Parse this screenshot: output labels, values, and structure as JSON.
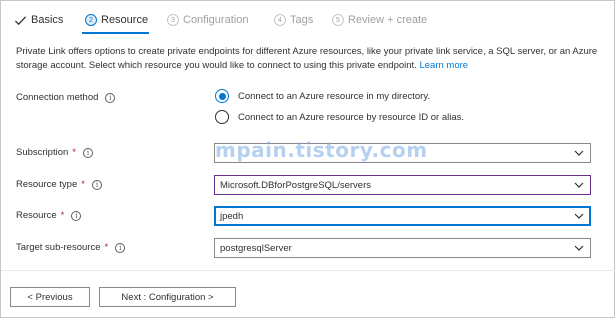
{
  "tabs": [
    {
      "label": "Basics",
      "state": "done"
    },
    {
      "num": "2",
      "label": "Resource",
      "state": "active"
    },
    {
      "num": "3",
      "label": "Configuration",
      "state": "disabled"
    },
    {
      "num": "4",
      "label": "Tags",
      "state": "disabled"
    },
    {
      "num": "5",
      "label": "Review + create",
      "state": "disabled"
    }
  ],
  "description": {
    "text": "Private Link offers options to create private endpoints for different Azure resources, like your private link service, a SQL server, or an Azure storage account. Select which resource you would like to connect to using this private endpoint.",
    "link": "Learn more"
  },
  "form": {
    "connection_method": {
      "label": "Connection method",
      "options": [
        {
          "label": "Connect to an Azure resource in my directory.",
          "checked": true
        },
        {
          "label": "Connect to an Azure resource by resource ID or alias.",
          "checked": false
        }
      ]
    },
    "subscription": {
      "label": "Subscription",
      "required": "*",
      "value": ""
    },
    "resource_type": {
      "label": "Resource type",
      "required": "*",
      "value": "Microsoft.DBforPostgreSQL/servers"
    },
    "resource": {
      "label": "Resource",
      "required": "*",
      "value": "jpedh"
    },
    "target_sub_resource": {
      "label": "Target sub-resource",
      "required": "*",
      "value": "postgresqlServer"
    }
  },
  "watermark": "mpain.tistory.com",
  "footer": {
    "previous_label": "< Previous",
    "next_label": "Next : Configuration >"
  },
  "colors": {
    "accent": "#0078d4",
    "required": "#a4262c",
    "focus_purple": "#6b2d8f"
  }
}
